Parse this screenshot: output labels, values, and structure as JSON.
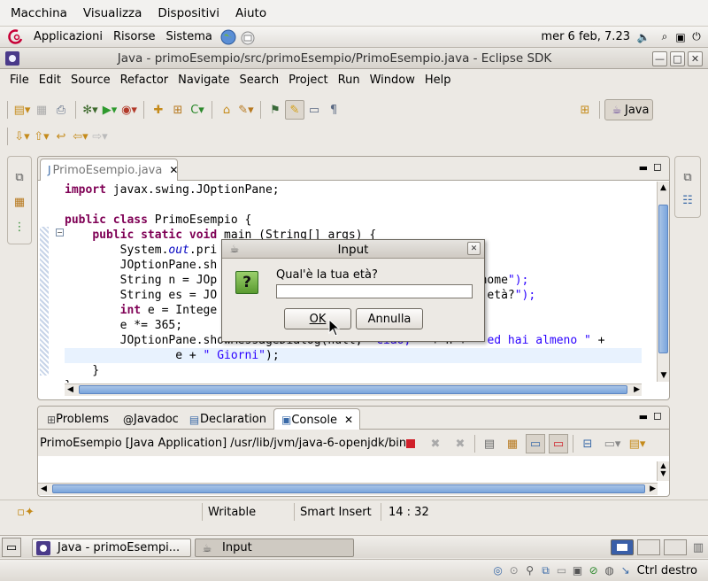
{
  "vm_menu": [
    "Macchina",
    "Visualizza",
    "Dispositivi",
    "Aiuto"
  ],
  "gnome_panel": {
    "menus": [
      "Applicazioni",
      "Risorse",
      "Sistema"
    ],
    "clock": "mer  6 feb,  7.23"
  },
  "window": {
    "title": "Java - primoEsempio/src/primoEsempio/PrimoEsempio.java - Eclipse SDK"
  },
  "menubar": [
    "File",
    "Edit",
    "Source",
    "Refactor",
    "Navigate",
    "Search",
    "Project",
    "Run",
    "Window",
    "Help"
  ],
  "perspective": {
    "label": "Java"
  },
  "editor": {
    "tab_label": "PrimoEsempio.java",
    "lines": [
      {
        "t": "import javax.swing.JOptionPane;"
      },
      {
        "t": ""
      },
      {
        "t": "public class PrimoEsempio {"
      },
      {
        "t": "    public static void main (String[] args) {"
      },
      {
        "t": "        System.out.pri"
      },
      {
        "t": "        JOptionPane.sh"
      },
      {
        "t": "        String n = JOp                                   uo nome\");"
      },
      {
        "t": "        String es = JO                                   tua età?\");"
      },
      {
        "t": "        int e = Intege"
      },
      {
        "t": "        e *= 365;"
      },
      {
        "t": "        JOptionPane.showMessageDialog(null, \"Ciao, \" + n + \" ed hai almeno \" +"
      },
      {
        "t": "                e + \" Giorni\");"
      },
      {
        "t": "    }"
      },
      {
        "t": "}"
      }
    ]
  },
  "bottom_tabs": [
    "Problems",
    "Javadoc",
    "Declaration",
    "Console"
  ],
  "console": {
    "header": "PrimoEsempio [Java Application] /usr/lib/jvm/java-6-openjdk/bin"
  },
  "status": {
    "writable": "Writable",
    "insert": "Smart Insert",
    "position": "14 : 32"
  },
  "taskbar": {
    "items": [
      "Java - primoEsempi...",
      "Input"
    ]
  },
  "tray": {
    "label": "Ctrl destro"
  },
  "dialog": {
    "title": "Input",
    "question": "Qual'è la tua età?",
    "input_value": "",
    "ok": "OK",
    "cancel": "Annulla"
  }
}
